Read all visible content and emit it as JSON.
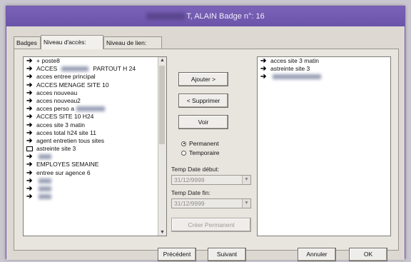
{
  "window": {
    "title": "T, ALAIN Badge n°: 16"
  },
  "tabs": [
    "Badges",
    "Niveau d'accès:",
    "Niveau de lien:"
  ],
  "available_list": [
    {
      "icon": "arrow",
      "label": "+ poste8"
    },
    {
      "icon": "arrow",
      "label": "ACCES",
      "suffix": "PARTOUT H 24"
    },
    {
      "icon": "arrow",
      "label": "acces entree principal"
    },
    {
      "icon": "arrow",
      "label": "ACCES MENAGE  SITE 10"
    },
    {
      "icon": "arrow",
      "label": "acces nouveau"
    },
    {
      "icon": "arrow",
      "label": "acces nouveau2"
    },
    {
      "icon": "arrow",
      "label": "acces perso a"
    },
    {
      "icon": "arrow",
      "label": "ACCES SITE 10 H24"
    },
    {
      "icon": "arrow",
      "label": "acces site 3 matin"
    },
    {
      "icon": "arrow",
      "label": "acces total h24 site 11"
    },
    {
      "icon": "arrow",
      "label": "agent entretien tous sites"
    },
    {
      "icon": "box",
      "label": "astreinte site 3"
    },
    {
      "icon": "arrow",
      "label": ""
    },
    {
      "icon": "arrow",
      "label": "EMPLOYES SEMAINE"
    },
    {
      "icon": "arrow",
      "label": "entree sur agence 6"
    },
    {
      "icon": "arrow",
      "label": ""
    },
    {
      "icon": "arrow",
      "label": ""
    },
    {
      "icon": "arrow",
      "label": ""
    }
  ],
  "assigned_list": [
    {
      "icon": "arrow",
      "label": "acces site 3 matin"
    },
    {
      "icon": "arrow",
      "label": "astreinte site 3"
    },
    {
      "icon": "arrow",
      "label": ""
    }
  ],
  "buttons": {
    "add": "Ajouter >",
    "remove": "< Supprimer",
    "view": "Voir",
    "make_permanent": "Créer Permanent",
    "previous": "Précédent",
    "next": "Suivant",
    "cancel": "Annuler",
    "ok": "OK"
  },
  "mode": {
    "permanent": "Permanent",
    "temporary": "Temporaire",
    "selected": "permanent"
  },
  "temp_start": {
    "label": "Temp Date début:",
    "value": "31/12/9999"
  },
  "temp_end": {
    "label": "Temp Date fin:",
    "value": "31/12/9999"
  }
}
